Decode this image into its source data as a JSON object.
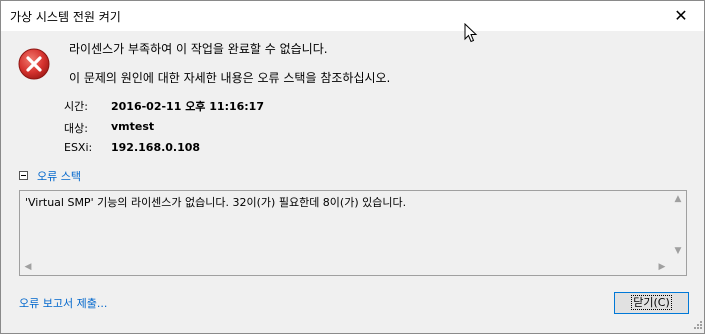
{
  "window": {
    "title": "가상 시스템 전원 켜기",
    "close_glyph": "✕"
  },
  "message": {
    "line1": "라이센스가 부족하여 이 작업을 완료할 수 없습니다.",
    "line2": "이 문제의 원인에 대한 자세한 내용은 오류 스택을 참조하십시오."
  },
  "details": [
    {
      "label": "시간:",
      "value": "2016-02-11 오후 11:16:17"
    },
    {
      "label": "대상:",
      "value": "vmtest"
    },
    {
      "label": "ESXi:",
      "value": "192.168.0.108"
    }
  ],
  "error_stack": {
    "label": "오류 스택",
    "text": "'Virtual SMP' 기능의 라이센스가 없습니다. 32이(가) 필요한데 8이(가) 있습니다."
  },
  "footer": {
    "report_link": "오류 보고서 제출...",
    "close_label": "닫기(C)"
  },
  "icons": {
    "error": "error-icon",
    "accent": "#0066cc",
    "error_red": "#d6332f"
  }
}
